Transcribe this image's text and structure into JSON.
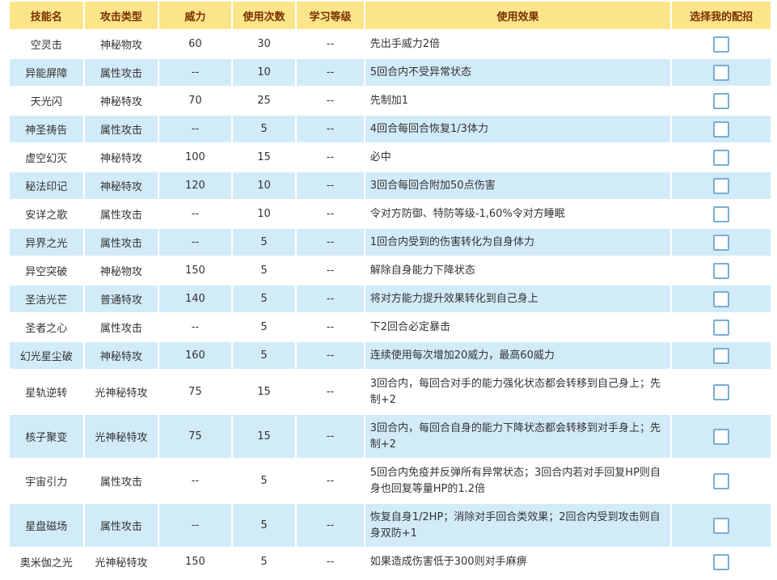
{
  "headers": [
    "技能名",
    "攻击类型",
    "威力",
    "使用次数",
    "学习等级",
    "使用效果",
    "选择我的配招"
  ],
  "rows": [
    {
      "name": "空灵击",
      "type": "神秘物攻",
      "power": "60",
      "uses": "30",
      "level": "--",
      "effect": "先出手威力2倍",
      "checked": false
    },
    {
      "name": "异能屏障",
      "type": "属性攻击",
      "power": "--",
      "uses": "10",
      "level": "--",
      "effect": "5回合内不受异常状态",
      "checked": false
    },
    {
      "name": "天光闪",
      "type": "神秘特攻",
      "power": "70",
      "uses": "25",
      "level": "--",
      "effect": "先制加1",
      "checked": false
    },
    {
      "name": "神圣祷告",
      "type": "属性攻击",
      "power": "--",
      "uses": "5",
      "level": "--",
      "effect": "4回合每回合恢复1/3体力",
      "checked": false
    },
    {
      "name": "虚空幻灭",
      "type": "神秘特攻",
      "power": "100",
      "uses": "15",
      "level": "--",
      "effect": "必中",
      "checked": false
    },
    {
      "name": "秘法印记",
      "type": "神秘特攻",
      "power": "120",
      "uses": "10",
      "level": "--",
      "effect": "3回合每回合附加50点伤害",
      "checked": false
    },
    {
      "name": "安详之歌",
      "type": "属性攻击",
      "power": "--",
      "uses": "10",
      "level": "--",
      "effect": "令对方防御、特防等级-1,60%令对方睡眠",
      "checked": false
    },
    {
      "name": "异界之光",
      "type": "属性攻击",
      "power": "--",
      "uses": "5",
      "level": "--",
      "effect": "1回合内受到的伤害转化为自身体力",
      "checked": false
    },
    {
      "name": "异空突破",
      "type": "神秘物攻",
      "power": "150",
      "uses": "5",
      "level": "--",
      "effect": "解除自身能力下降状态",
      "checked": false
    },
    {
      "name": "圣洁光芒",
      "type": "普通特攻",
      "power": "140",
      "uses": "5",
      "level": "--",
      "effect": "将对方能力提升效果转化到自己身上",
      "checked": false
    },
    {
      "name": "圣者之心",
      "type": "属性攻击",
      "power": "--",
      "uses": "5",
      "level": "--",
      "effect": "下2回合必定暴击",
      "checked": false
    },
    {
      "name": "幻光星尘破",
      "type": "神秘特攻",
      "power": "160",
      "uses": "5",
      "level": "--",
      "effect": "连续使用每次增加20威力，最高60威力",
      "checked": false
    },
    {
      "name": "星轨逆转",
      "type": "光神秘特攻",
      "power": "75",
      "uses": "15",
      "level": "--",
      "effect": "3回合内，每回合对手的能力强化状态都会转移到自己身上；先制+2",
      "checked": false
    },
    {
      "name": "核子聚变",
      "type": "光神秘特攻",
      "power": "75",
      "uses": "15",
      "level": "--",
      "effect": "3回合内，每回合自身的能力下降状态都会转移到对手身上；先制+2",
      "checked": false
    },
    {
      "name": "宇宙引力",
      "type": "属性攻击",
      "power": "--",
      "uses": "5",
      "level": "--",
      "effect": "5回合内免疫并反弹所有异常状态；3回合内若对手回复HP则自身也回复等量HP的1.2倍",
      "checked": false
    },
    {
      "name": "星盘磁场",
      "type": "属性攻击",
      "power": "--",
      "uses": "5",
      "level": "--",
      "effect": "恢复自身1/2HP；消除对手回合类效果；2回合内受到攻击则自身双防+1",
      "checked": false
    },
    {
      "name": "奥米伽之光",
      "type": "光神秘特攻",
      "power": "150",
      "uses": "5",
      "level": "--",
      "effect": "如果造成伤害低于300则对手麻痹",
      "checked": false
    }
  ]
}
